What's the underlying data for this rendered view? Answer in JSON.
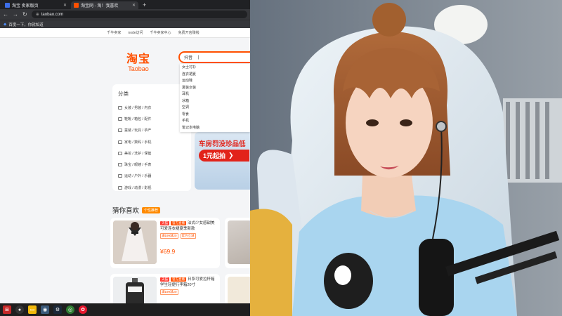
{
  "browser": {
    "tabs": [
      {
        "label": "淘宝 卖家版页",
        "active": false,
        "color": "#3d6ee8"
      },
      {
        "label": "淘宝网 - 淘！我喜欢",
        "active": true,
        "color": "#ff5000"
      }
    ],
    "new_tab_label": "+",
    "url": "taobao.com",
    "bookmarks_label": "百度一下，你就知道"
  },
  "page": {
    "site_nav": [
      "千牛卖家",
      "node访问",
      "千牛卖家中心",
      "免费开店赚钱"
    ],
    "logo": {
      "cn": "淘宝",
      "en": "Taobao"
    },
    "search": {
      "value": "抖音",
      "caret": "|"
    },
    "suggestions": [
      "女士衬衫",
      "连衣裙夏",
      "运动鞋",
      "夏装女装",
      "耳机",
      "冰箱",
      "空调",
      "零食",
      "手机",
      "笔记本电脑"
    ],
    "categories": {
      "title": "分类",
      "rows": [
        "女装 / 男装 / 内衣",
        "鞋靴 / 箱包 / 配件",
        "童装 / 玩具 / 孕产",
        "家电 / 数码 / 手机",
        "美妆 / 洗护 / 保健",
        "珠宝 / 眼镜 / 手表",
        "运动 / 户外 / 乐器",
        "游戏 / 动漫 / 影视"
      ]
    },
    "banner": {
      "text": "车房罚没珍品低",
      "button": "1元起拍",
      "arrow": "❯"
    },
    "guess": {
      "title": "猜你喜欢",
      "badge": "个性推荐"
    },
    "products": [
      {
        "tags": [
          "天猫",
          "官方直播"
        ],
        "title": "法式少女感甜美可爱连衣裙夏季新款",
        "coupons": [
          "满199减20",
          "官方立减"
        ],
        "price": "¥69.9"
      },
      {
        "tags": [
          "天猫",
          "官方直播"
        ],
        "title": "日系可爱拉杆箱学生轻便行李箱20寸",
        "coupons": [
          "满199减20"
        ],
        "price": ""
      }
    ]
  },
  "taskbar": {
    "icons": [
      "windows-icon",
      "obs-icon",
      "explorer-icon",
      "steam-icon",
      "chrome-icon",
      "weibo-icon"
    ]
  },
  "colors": {
    "taobao_orange": "#ff5000",
    "taskbar": "#1f1f1f"
  }
}
